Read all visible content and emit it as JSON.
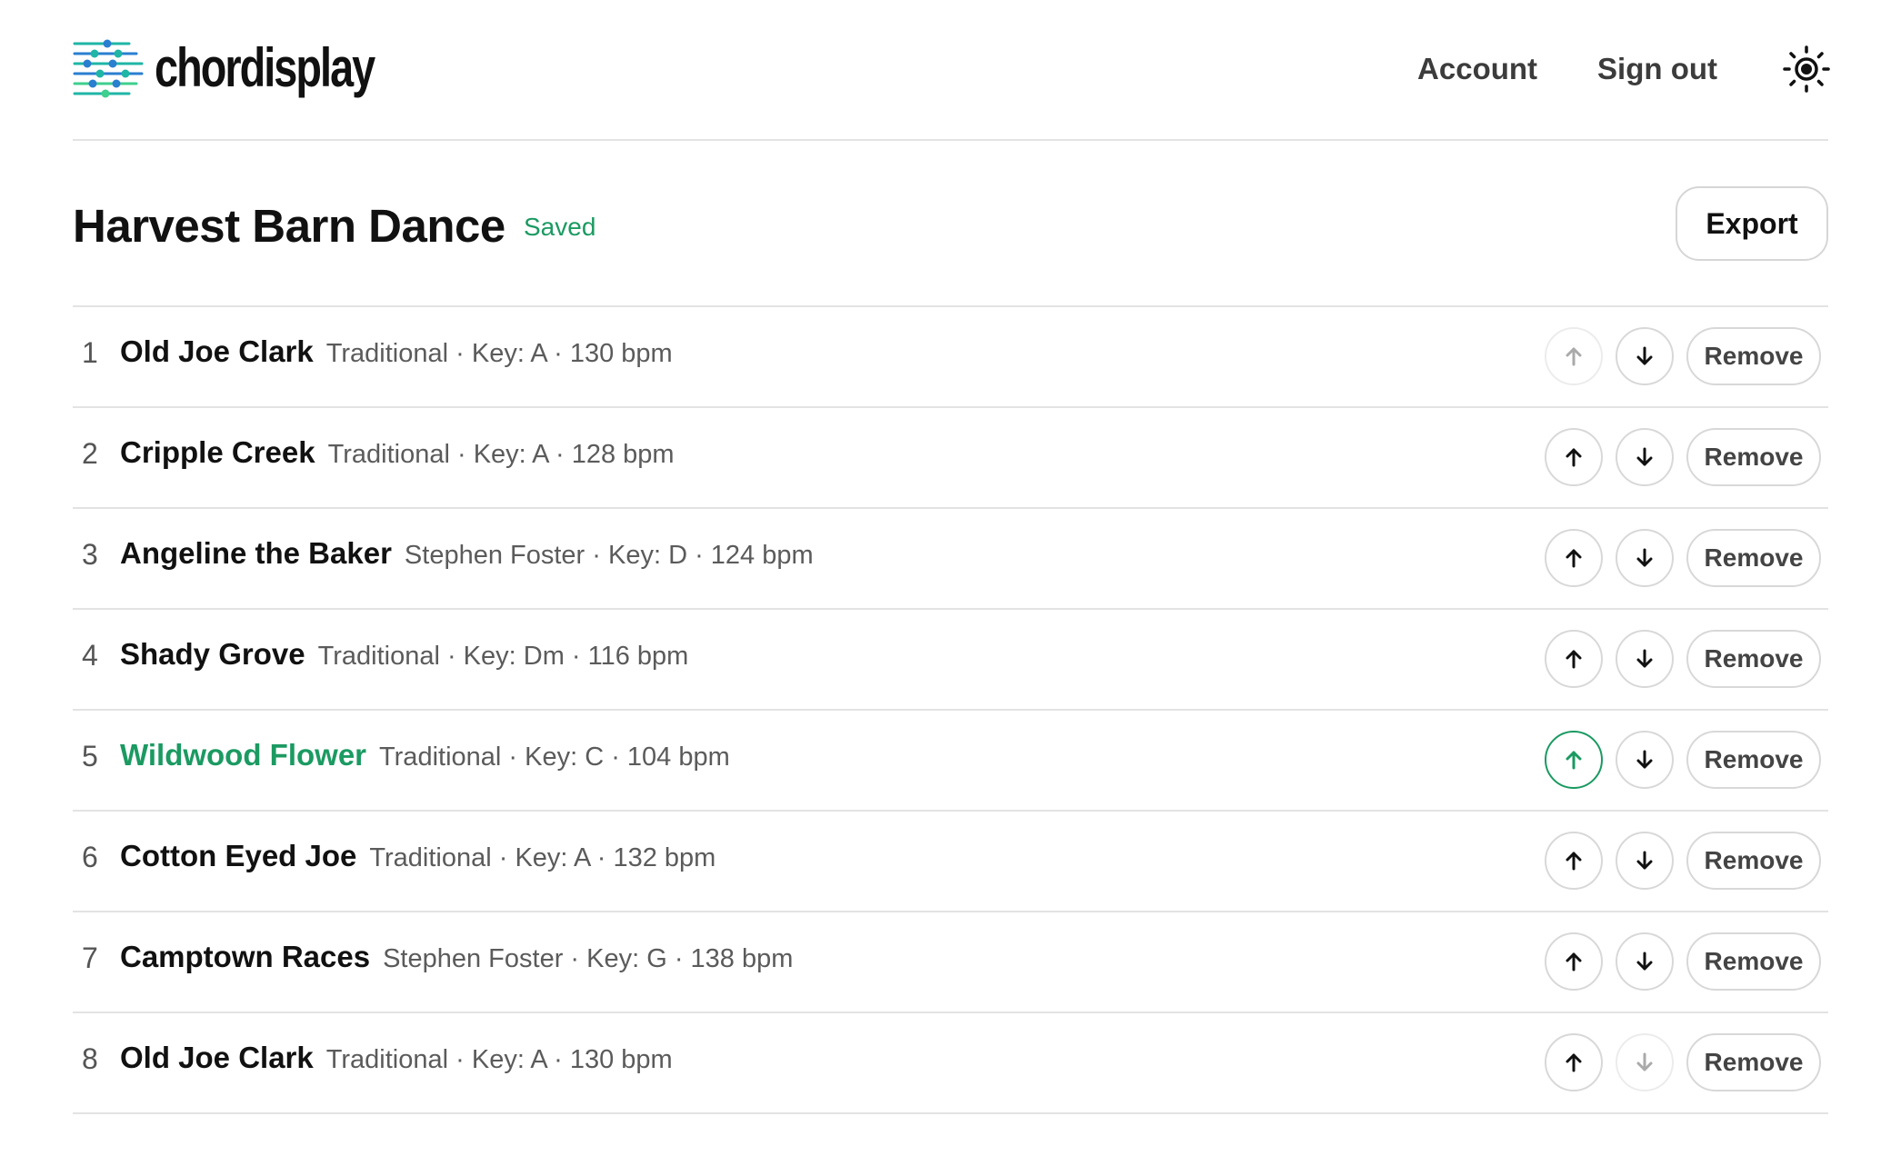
{
  "app": {
    "brand": "chordisplay",
    "colors": {
      "accent": "#1b9a62",
      "logo_teal": "#1fb6a6",
      "logo_blue": "#2a7fd0",
      "logo_green": "#3fcf8e"
    }
  },
  "header": {
    "nav": [
      {
        "label": "Account"
      },
      {
        "label": "Sign out"
      }
    ],
    "theme_icon": "sun-icon"
  },
  "setlist": {
    "title": "Harvest Barn Dance",
    "status": "Saved",
    "export_label": "Export"
  },
  "rows": [
    {
      "num": "1",
      "title": "Old Joe Clark",
      "meta": "Traditional · Key: A · 130 bpm",
      "remove": "Remove",
      "up_disabled": true,
      "down_disabled": false,
      "active": false
    },
    {
      "num": "2",
      "title": "Cripple Creek",
      "meta": "Traditional · Key: A · 128 bpm",
      "remove": "Remove",
      "up_disabled": false,
      "down_disabled": false,
      "active": false
    },
    {
      "num": "3",
      "title": "Angeline the Baker",
      "meta": "Stephen Foster · Key: D · 124 bpm",
      "remove": "Remove",
      "up_disabled": false,
      "down_disabled": false,
      "active": false
    },
    {
      "num": "4",
      "title": "Shady Grove",
      "meta": "Traditional · Key: Dm · 116 bpm",
      "remove": "Remove",
      "up_disabled": false,
      "down_disabled": false,
      "active": false
    },
    {
      "num": "5",
      "title": "Wildwood Flower",
      "meta": "Traditional · Key: C · 104 bpm",
      "remove": "Remove",
      "up_disabled": false,
      "down_disabled": false,
      "active": true
    },
    {
      "num": "6",
      "title": "Cotton Eyed Joe",
      "meta": "Traditional · Key: A · 132 bpm",
      "remove": "Remove",
      "up_disabled": false,
      "down_disabled": false,
      "active": false
    },
    {
      "num": "7",
      "title": "Camptown Races",
      "meta": "Stephen Foster · Key: G · 138 bpm",
      "remove": "Remove",
      "up_disabled": false,
      "down_disabled": false,
      "active": false
    },
    {
      "num": "8",
      "title": "Old Joe Clark",
      "meta": "Traditional · Key: A · 130 bpm",
      "remove": "Remove",
      "up_disabled": false,
      "down_disabled": true,
      "active": false
    }
  ]
}
